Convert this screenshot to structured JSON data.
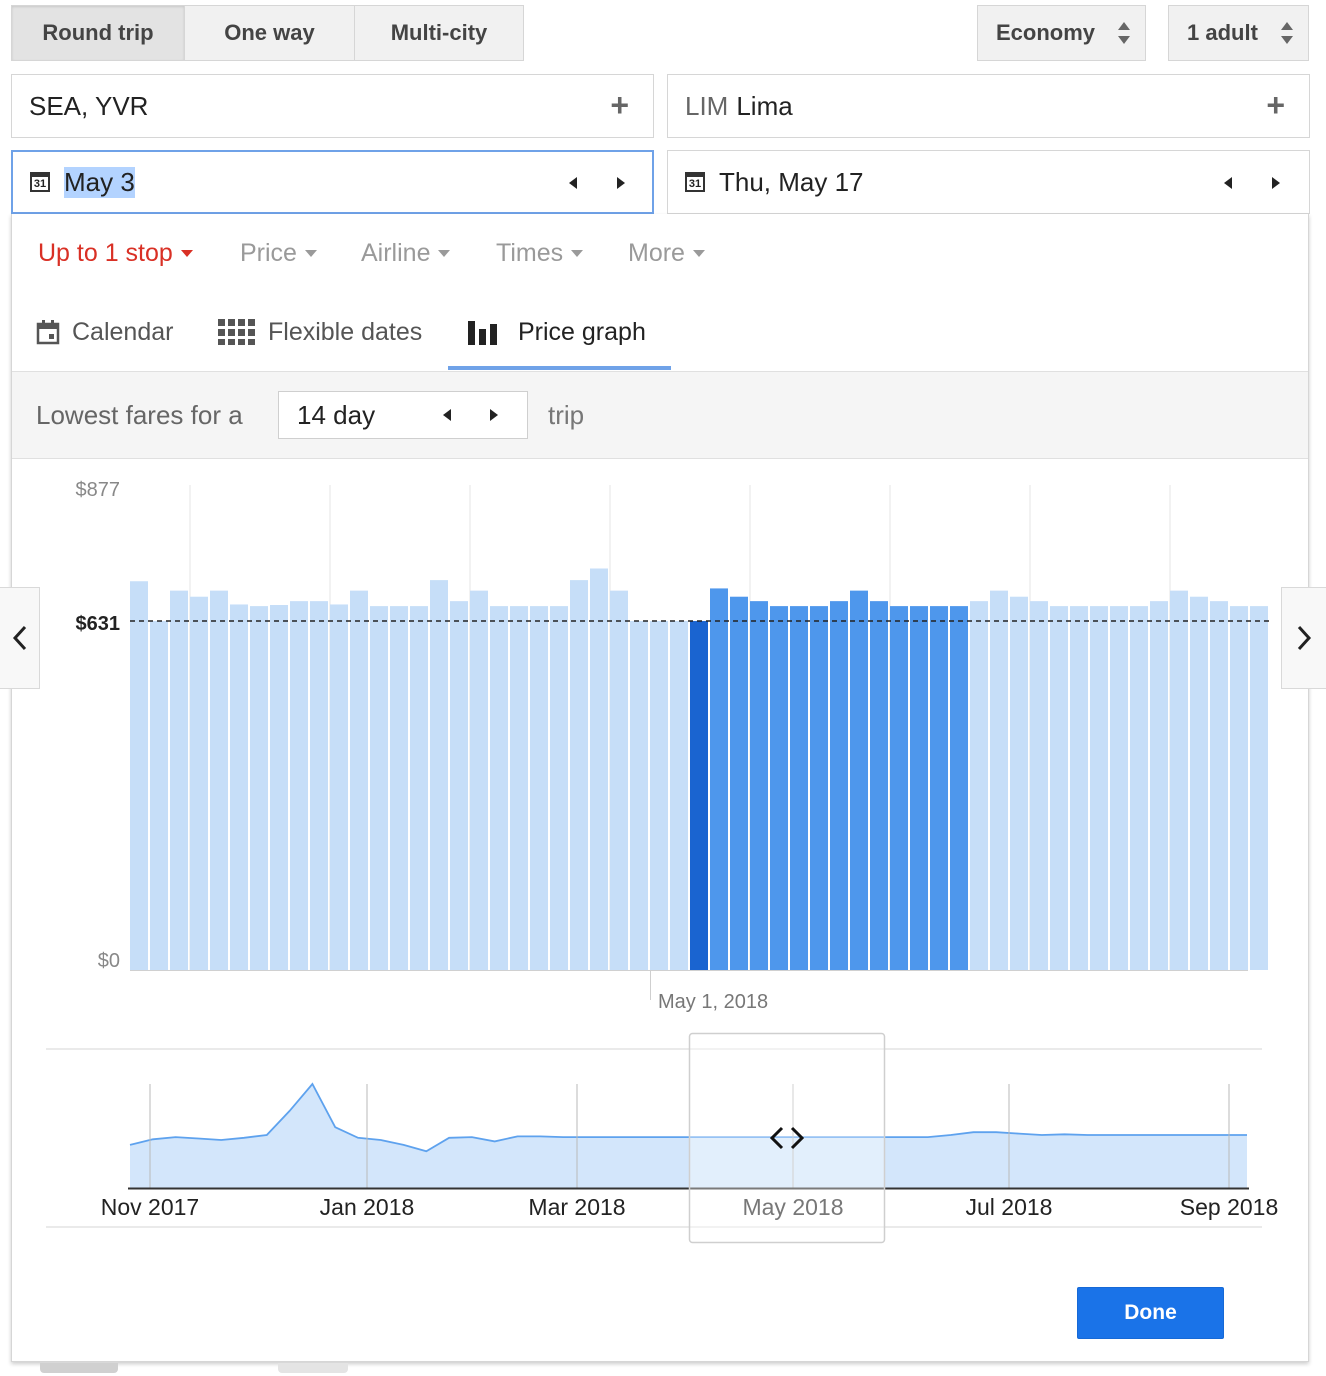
{
  "trip_types": [
    {
      "label": "Round trip",
      "active": true
    },
    {
      "label": "One way",
      "active": false
    },
    {
      "label": "Multi-city",
      "active": false
    }
  ],
  "cabin": {
    "label": "Economy"
  },
  "passengers": {
    "label": "1 adult"
  },
  "origin": {
    "value": "SEA, YVR"
  },
  "destination": {
    "code": "LIM",
    "name": "Lima"
  },
  "depart": {
    "value": "May 3",
    "icon": "calendar-31-icon",
    "icon_text": "31"
  },
  "return": {
    "value": "Thu, May 17",
    "icon": "calendar-31-icon",
    "icon_text": "31"
  },
  "filters": [
    {
      "label": "Up to 1 stop",
      "active": true
    },
    {
      "label": "Price",
      "active": false
    },
    {
      "label": "Airline",
      "active": false
    },
    {
      "label": "Times",
      "active": false
    },
    {
      "label": "More",
      "active": false
    }
  ],
  "view_tabs": [
    {
      "label": "Calendar",
      "icon": "calendar-icon"
    },
    {
      "label": "Flexible dates",
      "icon": "grid-icon"
    },
    {
      "label": "Price graph",
      "icon": "bar-chart-icon",
      "active": true
    }
  ],
  "trip_length": {
    "prefix": "Lowest fares for a",
    "value": "14 day",
    "suffix": "trip"
  },
  "done_label": "Done",
  "colors": {
    "accent": "#1a73e8",
    "bar_light": "#c6def8",
    "bar_mid": "#4e97ec",
    "bar_selected": "#1a64d0",
    "active_filter": "#d93025"
  },
  "chart_data": [
    {
      "type": "bar",
      "ylim": [
        0,
        877
      ],
      "ytick_labels": [
        "$877",
        "$631",
        "$0"
      ],
      "reference_line": {
        "value": 631,
        "label": "$631"
      },
      "x_label": "May 1, 2018",
      "selected_index": 28,
      "highlight_range": [
        28,
        42
      ],
      "values": [
        703,
        631,
        686,
        675,
        686,
        661,
        658,
        660,
        667,
        667,
        661,
        686,
        658,
        658,
        658,
        705,
        667,
        686,
        658,
        658,
        658,
        658,
        705,
        726,
        686,
        631,
        631,
        631,
        631,
        690,
        675,
        667,
        658,
        658,
        658,
        667,
        686,
        667,
        658,
        658,
        658,
        658,
        667,
        686,
        675,
        667,
        658,
        658,
        658,
        658,
        658,
        667,
        686,
        675,
        667,
        658,
        658
      ]
    },
    {
      "type": "area",
      "x_tick_labels": [
        "Nov 2017",
        "Jan 2018",
        "Mar 2018",
        "May 2018",
        "Jul 2018",
        "Sep 2018"
      ],
      "window_label": "May 2018",
      "values": [
        10,
        18,
        21,
        19,
        17,
        20,
        24,
        58,
        96,
        35,
        20,
        17,
        10,
        1,
        20,
        21,
        15,
        22,
        22,
        21,
        21,
        21,
        21,
        21,
        21,
        21,
        21,
        21,
        21,
        21,
        21,
        21,
        21,
        21,
        21,
        21,
        24,
        28,
        28,
        26,
        24,
        25,
        24,
        24,
        24,
        24,
        24,
        24,
        24,
        24
      ]
    }
  ]
}
